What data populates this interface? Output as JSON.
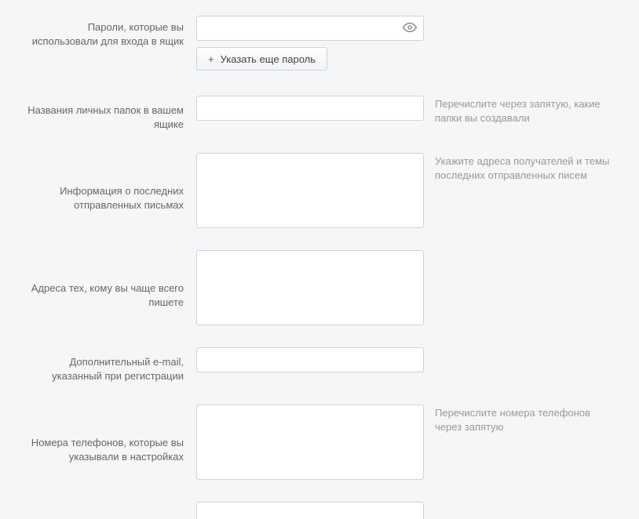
{
  "fields": {
    "passwords": {
      "label": "Пароли, которые вы использовали для входа в ящик",
      "add_button_label": "Указать еще пароль"
    },
    "folders": {
      "label": "Названия личных папок в вашем ящике",
      "hint": "Перечислите через запятую, какие папки вы создавали"
    },
    "sent_info": {
      "label": "Информация о последних отправленных письмах",
      "hint": "Укажите адреса получателей и темы последних отправленных писем"
    },
    "frequent_addresses": {
      "label": "Адреса тех, кому вы чаще всего пишете"
    },
    "extra_email": {
      "label": "Дополнительный e-mail, указанный при регистрации"
    },
    "phones": {
      "label": "Номера телефонов, которые вы указывали в настройках",
      "hint": "Перечислите номера телефонов через запятую"
    }
  }
}
